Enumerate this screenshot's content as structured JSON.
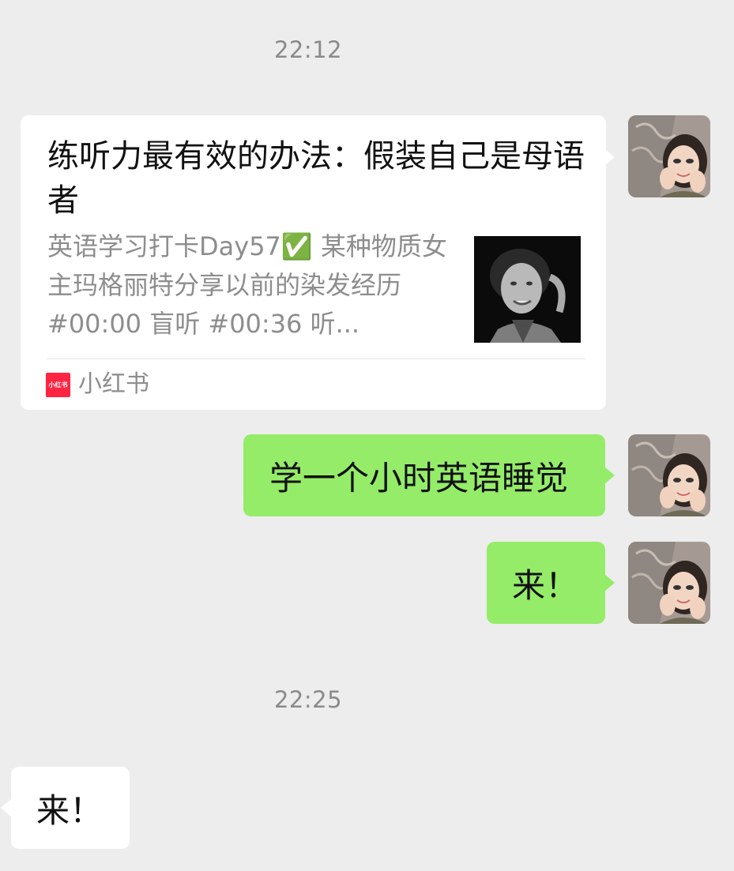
{
  "messages": {
    "time_1": "22:12",
    "time_2": "22:25"
  },
  "link_card": {
    "title": "练听力最有效的办法：假装自己是母语者",
    "description": "英语学习打卡Day57✅ 某种物质女主玛格丽特分享以前的染发经历 #00:00 盲听 #00:36 听...",
    "source_icon_text": "小红书",
    "source_name": "小红书",
    "source_color": "#ff2442"
  },
  "outgoing": {
    "msg_1": "学一个小时英语睡觉",
    "msg_2": "来！"
  },
  "incoming": {
    "msg_1": "来！"
  },
  "colors": {
    "background": "#ededed",
    "outgoing_bubble": "#95ec69",
    "incoming_bubble": "#ffffff",
    "timestamp": "#8a8a8a"
  },
  "icons": {
    "avatar": "user-avatar",
    "thumbnail": "article-thumbnail",
    "source": "xiaohongshu-logo-icon"
  }
}
